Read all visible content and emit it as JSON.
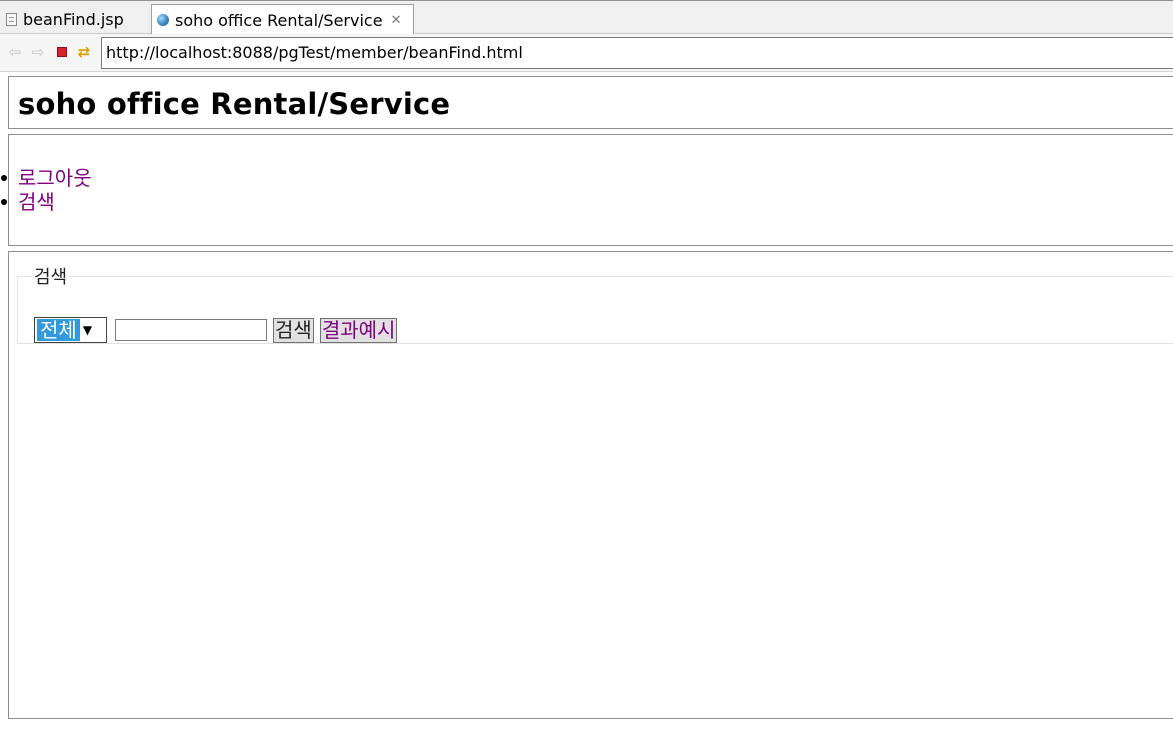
{
  "editor_tabs": [
    {
      "label": "beanFind.jsp",
      "icon": "jsp-file-icon",
      "active": false
    },
    {
      "label": "soho office Rental/Service",
      "icon": "globe-icon",
      "active": true,
      "close_glyph": "✕"
    }
  ],
  "toolbar": {
    "back_glyph": "⇦",
    "forward_glyph": "⇨",
    "refresh_glyph": "⇄",
    "url": "http://localhost:8088/pgTest/member/beanFind.html"
  },
  "page": {
    "title": "soho office Rental/Service",
    "nav": [
      {
        "label": "로그아웃"
      },
      {
        "label": "검색"
      }
    ],
    "search": {
      "legend": "검색",
      "select_value": "전체",
      "input_value": "",
      "search_button": "검색",
      "example_button": "결과예시"
    }
  },
  "colors": {
    "link_visited": "#800080",
    "select_highlight": "#3399dd",
    "stop_red": "#d4232a"
  }
}
